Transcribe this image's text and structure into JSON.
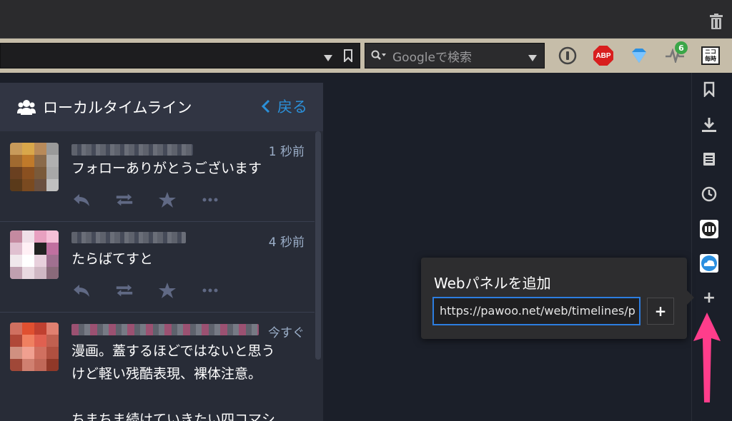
{
  "toolbar": {
    "search_placeholder": "Googleで検索",
    "adblock_label": "ABP",
    "activity_badge": "6",
    "niko_label_top": "ニコ",
    "niko_label_bottom": "毎時"
  },
  "column": {
    "title": "ローカルタイムライン",
    "back_label": "戻る",
    "statuses": [
      {
        "time": "1 秒前",
        "content": "フォローありがとうございます"
      },
      {
        "time": "4 秒前",
        "content": "たらばてすと"
      },
      {
        "time": "今すぐ",
        "content": "漫画。蓋するほどではないと思う\nけど軽い残酷表現、裸体注意。\n\nちまちま続けていきたい四コマシ"
      }
    ]
  },
  "popup": {
    "title": "Webパネルを追加",
    "url_value": "https://pawoo.net/web/timelines/p",
    "add_label": "+"
  },
  "sidebar": {
    "plus_label": "+"
  },
  "colors": {
    "accent": "#2b90d9",
    "arrow": "#ff3d8b",
    "toolbar": "#c6bda9",
    "column_bg": "#282c37"
  }
}
